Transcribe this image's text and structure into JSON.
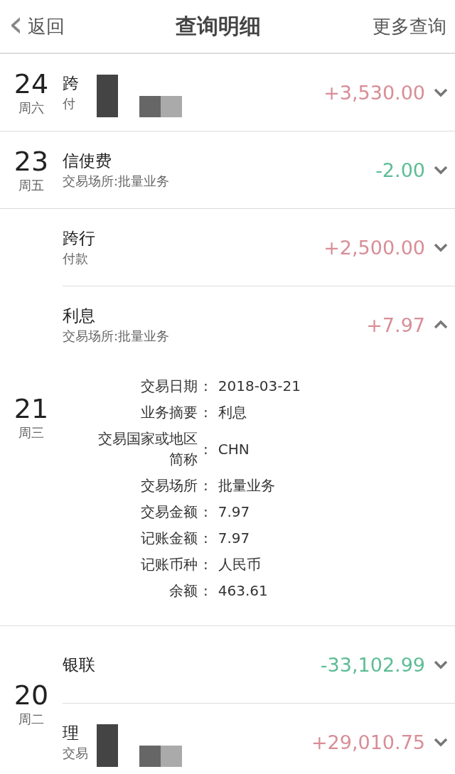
{
  "header": {
    "back": {
      "icon": "‹",
      "label": "返回"
    },
    "title": "查询明细",
    "more": "更多查询"
  },
  "groups": [
    {
      "day": "24",
      "weekday": "周六",
      "entries": [
        {
          "title": "跨",
          "subtitle": "付",
          "amount": "+3,530.00",
          "kind": "income",
          "redacted": true,
          "expanded": false
        }
      ]
    },
    {
      "day": "23",
      "weekday": "周五",
      "entries": [
        {
          "title": "信使费",
          "subtitle": "交易场所:批量业务",
          "amount": "-2.00",
          "kind": "expense",
          "redacted": false,
          "expanded": false
        }
      ]
    },
    {
      "day": "21",
      "weekday": "周三",
      "entries": [
        {
          "title": "跨行",
          "subtitle": "付款",
          "amount": "+2,500.00",
          "kind": "income",
          "redacted": false,
          "expanded": false
        },
        {
          "title": "利息",
          "subtitle": "交易场所:批量业务",
          "amount": "+7.97",
          "kind": "income",
          "redacted": false,
          "expanded": true,
          "details": [
            {
              "label": "交易日期",
              "separator": ":",
              "value": "2018-03-21"
            },
            {
              "label": "业务摘要",
              "separator": ":",
              "value": "利息"
            },
            {
              "label": "交易国家或地区简称",
              "separator": ":",
              "value": "CHN"
            },
            {
              "label": "交易场所",
              "separator": ":",
              "value": "批量业务"
            },
            {
              "label": "交易金额",
              "separator": ":",
              "value": "7.97"
            },
            {
              "label": "记账金额",
              "separator": ":",
              "value": "7.97"
            },
            {
              "label": "记账币种",
              "separator": ":",
              "value": "人民币"
            },
            {
              "label": "余额",
              "separator": ":",
              "value": "463.61"
            }
          ]
        }
      ]
    },
    {
      "day": "20",
      "weekday": "周二",
      "entries": [
        {
          "title": "银联",
          "amount": "-33,102.99",
          "kind": "expense",
          "redacted": false,
          "expanded": false
        },
        {
          "title": "理",
          "subtitle": "交易",
          "amount": "+29,010.75",
          "kind": "income",
          "redacted": true,
          "expanded": false
        }
      ]
    }
  ]
}
